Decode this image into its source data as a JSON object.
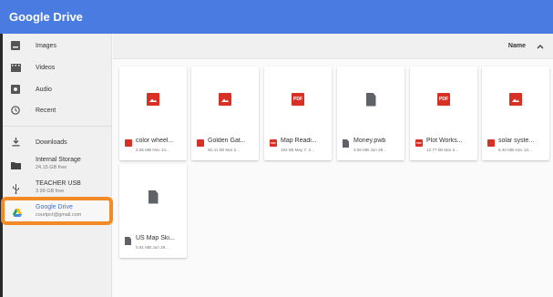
{
  "app": {
    "title": "Google Drive"
  },
  "sidebar": {
    "items": [
      {
        "label": "Images",
        "icon": "image-icon"
      },
      {
        "label": "Videos",
        "icon": "film-icon"
      },
      {
        "label": "Audio",
        "icon": "audio-icon"
      },
      {
        "label": "Recent",
        "icon": "clock-icon"
      },
      {
        "label": "Downloads",
        "icon": "download-icon"
      },
      {
        "label": "Internal Storage",
        "sub": "24.15 GB free",
        "icon": "folder-icon"
      },
      {
        "label": "TEACHER USB",
        "sub": "3.99 GB free",
        "icon": "usb-icon"
      },
      {
        "label": "Google Drive",
        "sub": "courtpct@gmail.com",
        "icon": "google-drive-icon"
      }
    ]
  },
  "toolbar": {
    "sort_label": "Name",
    "sort_direction": "ascending"
  },
  "files": [
    {
      "name": "color wheel...",
      "meta": "2.55 MB Nov 14...",
      "type": "image"
    },
    {
      "name": "Golden Gat...",
      "meta": "92.41 kB Mar 2...",
      "type": "image"
    },
    {
      "name": "Map Readi...",
      "meta": "194 kB May 7, 2...",
      "type": "pdf"
    },
    {
      "name": "Money.pwb",
      "meta": "3.56 MB Jun 29...",
      "type": "doc"
    },
    {
      "name": "Plot Works...",
      "meta": "12.77 kB Mar 2...",
      "type": "pdf"
    },
    {
      "name": "solar syste...",
      "meta": "6.40 MB Nov 13...",
      "type": "image"
    },
    {
      "name": "US Map Ski...",
      "meta": "0.91 MB Jun 29...",
      "type": "doc"
    }
  ],
  "colors": {
    "appbar": "#4a7be0",
    "highlight": "#f28b25",
    "file_red": "#d93025",
    "doc_grey": "#5f6368"
  },
  "pdf_badge": "PDF"
}
